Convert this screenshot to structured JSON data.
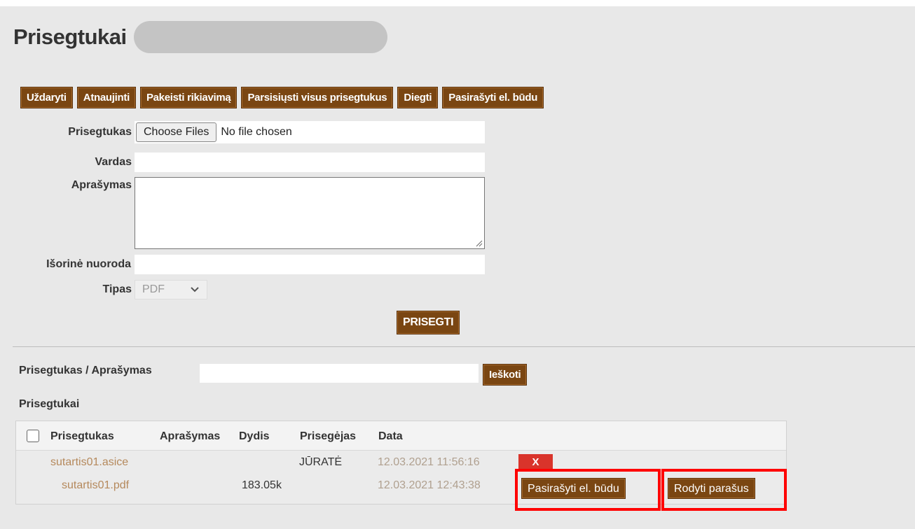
{
  "page": {
    "title": "Prisegtukai"
  },
  "toolbar": {
    "buttons": [
      {
        "label": "Uždaryti"
      },
      {
        "label": "Atnaujinti"
      },
      {
        "label": "Pakeisti rikiavimą"
      },
      {
        "label": "Parsisiųsti visus prisegtukus"
      },
      {
        "label": "Diegti"
      },
      {
        "label": "Pasirašyti el. būdu"
      }
    ]
  },
  "form": {
    "attachment_label": "Prisegtukas",
    "choose_files": "Choose Files",
    "no_file": "No file chosen",
    "name_label": "Vardas",
    "description_label": "Aprašymas",
    "external_link_label": "Išorinė nuoroda",
    "type_label": "Tipas",
    "type_value": "PDF",
    "submit": "PRISEGTI"
  },
  "search": {
    "label": "Prisegtukas / Aprašymas",
    "button": "Ieškoti"
  },
  "list": {
    "section_label": "Prisegtukai",
    "columns": [
      "Prisegtukas",
      "Aprašymas",
      "Dydis",
      "Prisegėjas",
      "Data"
    ],
    "rows": [
      {
        "file": "sutartis01.asice",
        "description": "",
        "size": "",
        "uploader": "JŪRATĖ",
        "date": "12.03.2021 11:56:16",
        "delete": "X"
      },
      {
        "file": "sutartis01.pdf",
        "description": "",
        "size": "183.05k",
        "uploader": "",
        "date": "12.03.2021 12:43:38"
      }
    ],
    "sign_button": "Pasirašyti el. būdu",
    "show_signatures_button": "Rodyti parašus"
  },
  "colors": {
    "button_bg": "#7a4612",
    "highlight": "#ff0000",
    "delete_bg": "#d9342b"
  }
}
